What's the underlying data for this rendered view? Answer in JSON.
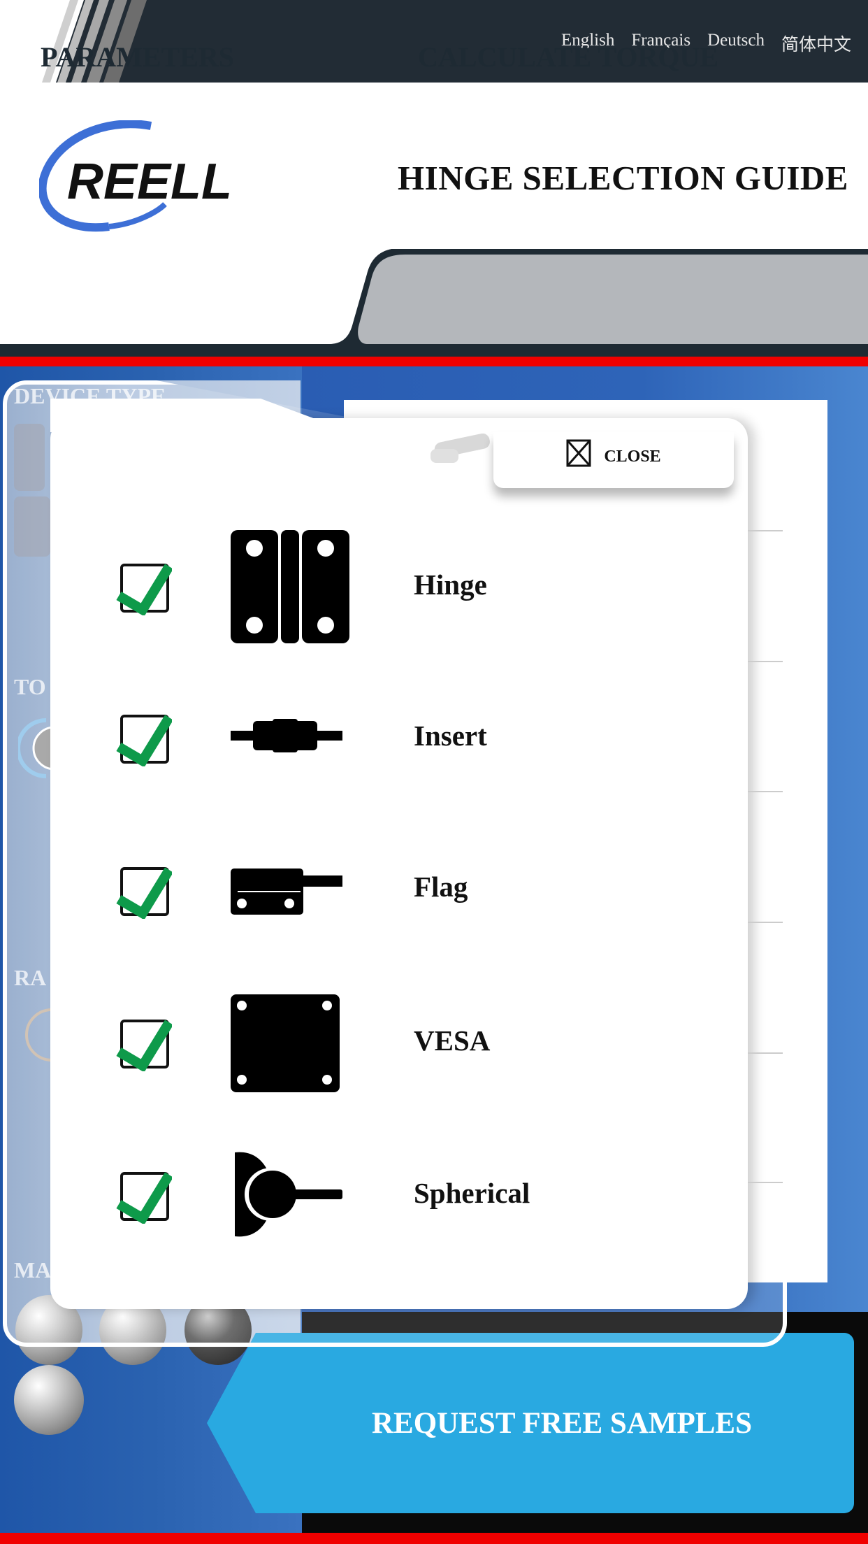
{
  "languages": [
    "English",
    "Français",
    "Deutsch",
    "简体中文"
  ],
  "header": {
    "logo_text": "REELL",
    "title": "HINGE SELECTION GUIDE"
  },
  "tabs": [
    {
      "label": "PARAMETERS",
      "active": true
    },
    {
      "label": "CALCULATE TORQUE",
      "active": false
    }
  ],
  "background": {
    "section_labels": [
      "DEVICE TYPE",
      "TO",
      "RA",
      "MA"
    ]
  },
  "modal": {
    "close_label": "CLOSE",
    "close_icon": "close-box-icon",
    "items": [
      {
        "label": "Hinge",
        "checked": true,
        "icon": "hinge-icon"
      },
      {
        "label": "Insert",
        "checked": true,
        "icon": "insert-icon"
      },
      {
        "label": "Flag",
        "checked": true,
        "icon": "flag-icon"
      },
      {
        "label": "VESA",
        "checked": true,
        "icon": "vesa-icon"
      },
      {
        "label": "Spherical",
        "checked": true,
        "icon": "spherical-icon"
      }
    ]
  },
  "cta": {
    "label": "REQUEST FREE SAMPLES"
  },
  "colors": {
    "topbar": "#222c35",
    "accent_red": "#f00000",
    "cta_blue": "#29a9e1",
    "check_green": "#0e9a4a",
    "panel_blue": "#2a5db3",
    "logo_blue": "#3d6fd6"
  }
}
